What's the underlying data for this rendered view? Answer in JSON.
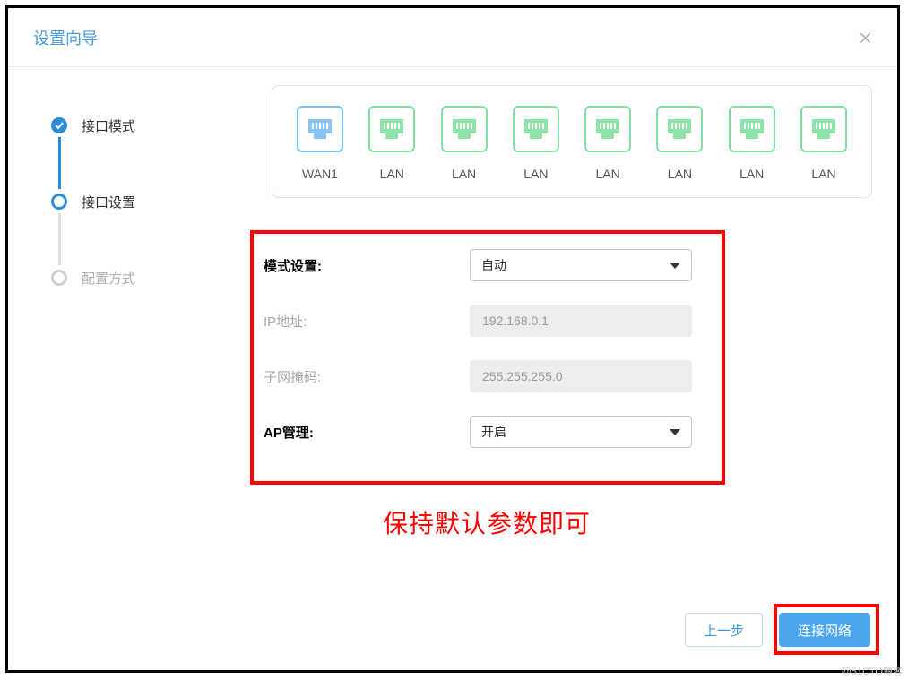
{
  "dialog": {
    "title": "设置向导",
    "close_label": "×"
  },
  "steps": [
    {
      "label": "接口模式",
      "state": "done"
    },
    {
      "label": "接口设置",
      "state": "active"
    },
    {
      "label": "配置方式",
      "state": "pending"
    }
  ],
  "ports": [
    {
      "label": "WAN1",
      "kind": "wan"
    },
    {
      "label": "LAN",
      "kind": "lan"
    },
    {
      "label": "LAN",
      "kind": "lan"
    },
    {
      "label": "LAN",
      "kind": "lan"
    },
    {
      "label": "LAN",
      "kind": "lan"
    },
    {
      "label": "LAN",
      "kind": "lan"
    },
    {
      "label": "LAN",
      "kind": "lan"
    },
    {
      "label": "LAN",
      "kind": "lan"
    }
  ],
  "form": {
    "mode_label": "模式设置:",
    "mode_value": "自动",
    "ip_label": "IP地址:",
    "ip_value": "192.168.0.1",
    "subnet_label": "子网掩码:",
    "subnet_value": "255.255.255.0",
    "ap_label": "AP管理:",
    "ap_value": "开启"
  },
  "annotation": "保持默认参数即可",
  "buttons": {
    "prev": "上一步",
    "next": "连接网络"
  },
  "watermark": "@51CTO博客",
  "colors": {
    "primary": "#4ba6ef",
    "highlight_border": "#ff0000",
    "wan_border": "#7bbef3",
    "lan_border": "#82e0a0"
  }
}
